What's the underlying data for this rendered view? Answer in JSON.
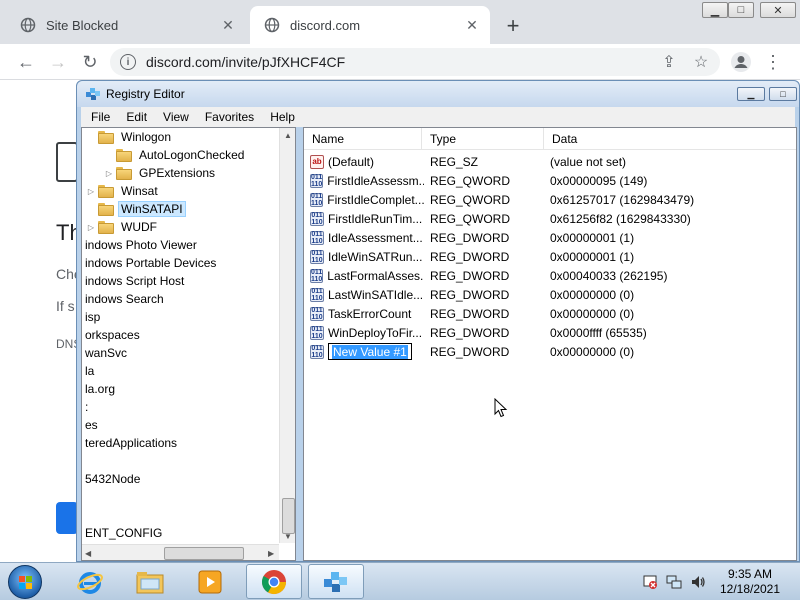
{
  "browser": {
    "tabs": [
      {
        "title": "Site Blocked",
        "active": false
      },
      {
        "title": "discord.com",
        "active": true
      }
    ],
    "new_tab": "+",
    "address": "discord.com/invite/pJfXHCF4CF",
    "page_fragments": {
      "heading": "Th",
      "line1": "Che",
      "line2": "If s",
      "line3": "DNS"
    }
  },
  "regedit": {
    "title": "Registry Editor",
    "menu": [
      "File",
      "Edit",
      "View",
      "Favorites",
      "Help"
    ],
    "tree": [
      {
        "label": "Winlogon",
        "indent": 1,
        "folder": true,
        "expander": "",
        "selected": false
      },
      {
        "label": "AutoLogonChecked",
        "indent": 2,
        "folder": true,
        "expander": "",
        "selected": false
      },
      {
        "label": "GPExtensions",
        "indent": 2,
        "folder": true,
        "expander": "▷",
        "selected": false
      },
      {
        "label": "Winsat",
        "indent": 1,
        "folder": true,
        "expander": "▷",
        "selected": false
      },
      {
        "label": "WinSATAPI",
        "indent": 1,
        "folder": true,
        "expander": "",
        "selected": true
      },
      {
        "label": "WUDF",
        "indent": 1,
        "folder": true,
        "expander": "▷",
        "selected": false
      },
      {
        "label": "indows Photo Viewer",
        "indent": 0,
        "folder": false,
        "expander": "",
        "selected": false
      },
      {
        "label": "indows Portable Devices",
        "indent": 0,
        "folder": false,
        "expander": "",
        "selected": false
      },
      {
        "label": "indows Script Host",
        "indent": 0,
        "folder": false,
        "expander": "",
        "selected": false
      },
      {
        "label": "indows Search",
        "indent": 0,
        "folder": false,
        "expander": "",
        "selected": false
      },
      {
        "label": "isp",
        "indent": 0,
        "folder": false,
        "expander": "",
        "selected": false
      },
      {
        "label": "orkspaces",
        "indent": 0,
        "folder": false,
        "expander": "",
        "selected": false
      },
      {
        "label": "wanSvc",
        "indent": 0,
        "folder": false,
        "expander": "",
        "selected": false
      },
      {
        "label": "la",
        "indent": 0,
        "folder": false,
        "expander": "",
        "selected": false
      },
      {
        "label": "la.org",
        "indent": 0,
        "folder": false,
        "expander": "",
        "selected": false
      },
      {
        "label": ":",
        "indent": 0,
        "folder": false,
        "expander": "",
        "selected": false
      },
      {
        "label": "es",
        "indent": 0,
        "folder": false,
        "expander": "",
        "selected": false
      },
      {
        "label": "teredApplications",
        "indent": 0,
        "folder": false,
        "expander": "",
        "selected": false
      },
      {
        "label": "",
        "indent": 0,
        "folder": false,
        "expander": "",
        "selected": false
      },
      {
        "label": "5432Node",
        "indent": 0,
        "folder": false,
        "expander": "",
        "selected": false
      },
      {
        "label": "",
        "indent": 0,
        "folder": false,
        "expander": "",
        "selected": false
      },
      {
        "label": "",
        "indent": 0,
        "folder": false,
        "expander": "",
        "selected": false
      },
      {
        "label": "ENT_CONFIG",
        "indent": 0,
        "folder": false,
        "expander": "",
        "selected": false
      }
    ],
    "columns": {
      "name": "Name",
      "type": "Type",
      "data": "Data"
    },
    "values": [
      {
        "name": "(Default)",
        "type": "REG_SZ",
        "data": "(value not set)",
        "icon": "ab",
        "editing": false
      },
      {
        "name": "FirstIdleAssessm...",
        "type": "REG_QWORD",
        "data": "0x00000095 (149)",
        "icon": "bin",
        "editing": false
      },
      {
        "name": "FirstIdleComplet...",
        "type": "REG_QWORD",
        "data": "0x61257017 (1629843479)",
        "icon": "bin",
        "editing": false
      },
      {
        "name": "FirstIdleRunTim...",
        "type": "REG_QWORD",
        "data": "0x61256f82 (1629843330)",
        "icon": "bin",
        "editing": false
      },
      {
        "name": "IdleAssessment...",
        "type": "REG_DWORD",
        "data": "0x00000001 (1)",
        "icon": "bin",
        "editing": false
      },
      {
        "name": "IdleWinSATRun...",
        "type": "REG_DWORD",
        "data": "0x00000001 (1)",
        "icon": "bin",
        "editing": false
      },
      {
        "name": "LastFormalAsses...",
        "type": "REG_DWORD",
        "data": "0x00040033 (262195)",
        "icon": "bin",
        "editing": false
      },
      {
        "name": "LastWinSATIdle...",
        "type": "REG_DWORD",
        "data": "0x00000000 (0)",
        "icon": "bin",
        "editing": false
      },
      {
        "name": "TaskErrorCount",
        "type": "REG_DWORD",
        "data": "0x00000000 (0)",
        "icon": "bin",
        "editing": false
      },
      {
        "name": "WinDeployToFir...",
        "type": "REG_DWORD",
        "data": "0x0000ffff (65535)",
        "icon": "bin",
        "editing": false
      },
      {
        "name": "New Value #1",
        "type": "REG_DWORD",
        "data": "0x00000000 (0)",
        "icon": "bin",
        "editing": true
      }
    ]
  },
  "taskbar": {
    "apps": [
      "internet-explorer-icon",
      "file-explorer-icon",
      "media-player-icon",
      "chrome-icon",
      "regedit-icon"
    ],
    "time": "9:35 AM",
    "date": "12/18/2021"
  },
  "colors": {
    "selection": "#3399ff",
    "tree_selected": "#cce8ff",
    "folder": "#f7d57a",
    "chrome_tabstrip": "#dee1e6"
  }
}
